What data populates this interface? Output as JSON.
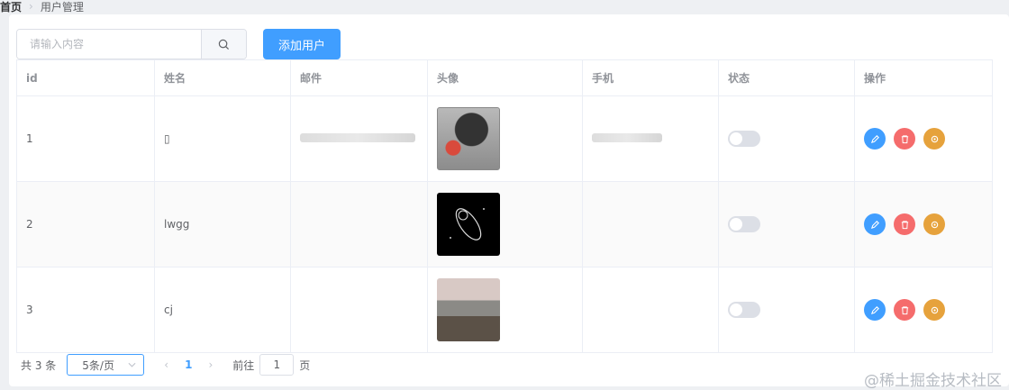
{
  "breadcrumb": {
    "home": "首页",
    "current": "用户管理"
  },
  "toolbar": {
    "search_placeholder": "请输入内容",
    "add_label": "添加用户"
  },
  "table": {
    "headers": [
      "id",
      "姓名",
      "邮件",
      "头像",
      "手机",
      "状态",
      "操作"
    ],
    "rows": [
      {
        "id": "1",
        "name": "▯",
        "status_on": false
      },
      {
        "id": "2",
        "name": "lwgg",
        "status_on": false
      },
      {
        "id": "3",
        "name": "cj",
        "status_on": false
      }
    ]
  },
  "pagination": {
    "total": "共 3 条",
    "page_size": "5条/页",
    "current_page": "1",
    "goto_label": "前往",
    "goto_value": "1",
    "page_suffix": "页"
  },
  "watermark": "@稀土掘金技术社区",
  "colors": {
    "primary": "#409eff",
    "danger": "#f56c6c",
    "warning": "#e6a23c"
  }
}
